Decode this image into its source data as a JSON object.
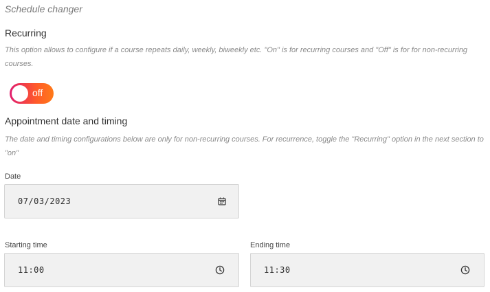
{
  "page": {
    "title": "Schedule changer"
  },
  "recurring": {
    "heading": "Recurring",
    "description": "This option allows to configure if a course repeats daily, weekly, biweekly etc. \"On\" is for recurring courses and \"Off\" is for for non-recurring courses.",
    "toggle_label": "off"
  },
  "appointment": {
    "heading": "Appointment date and timing",
    "description": "The date and timing configurations below are only for non-recurring courses. For recurrence, toggle the \"Recurring\" option in the next section to \"on\"",
    "date": {
      "label": "Date",
      "value": "07/03/2023",
      "icon": "calendar-icon"
    },
    "start_time": {
      "label": "Starting time",
      "value": "11:00",
      "icon": "clock-icon"
    },
    "end_time": {
      "label": "Ending time",
      "value": "11:30",
      "icon": "clock-icon"
    }
  },
  "colors": {
    "toggle_start": "#e01c6e",
    "toggle_end": "#ff7a18",
    "field_bg": "#f1f1f1"
  }
}
